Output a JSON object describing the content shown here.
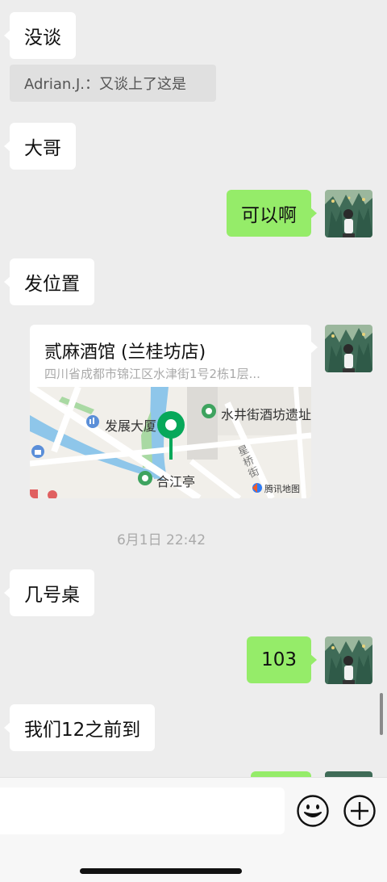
{
  "messages": {
    "m1": "没谈",
    "quote": "Adrian.J.：又谈上了这是",
    "m2": "大哥",
    "m3": "可以啊",
    "m4": "发位置",
    "m5": "几号桌",
    "m6": "103",
    "m7": "我们12之前到"
  },
  "location": {
    "title": "贰麻酒馆 (兰桂坊店)",
    "address": "四川省成都市锦江区水津街1号2栋1层...",
    "poi_1": "发展大厦",
    "poi_2": "水井街酒坊遗址",
    "poi_3": "合江亭",
    "street": "星桥街",
    "provider": "腾讯地图"
  },
  "timestamp": "6月1日 22:42",
  "icons": {
    "emoji": "emoji-icon",
    "more": "plus-icon"
  },
  "colors": {
    "sent_bubble": "#95ec69",
    "received_bubble": "#ffffff",
    "background": "#ededed"
  }
}
